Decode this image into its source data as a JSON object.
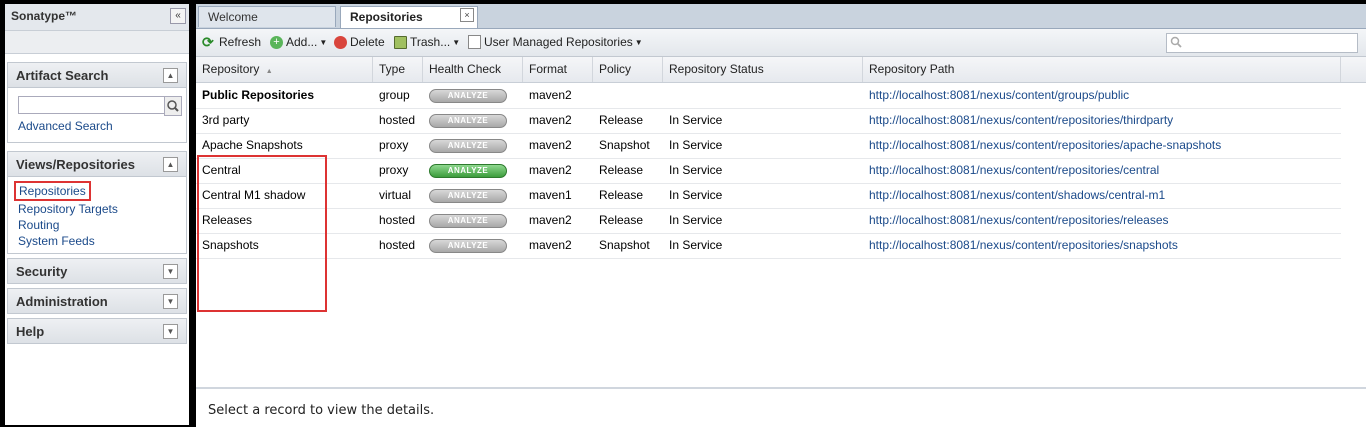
{
  "sidebar": {
    "brand": "Sonatype™",
    "collapse_glyph": "«",
    "artifact_search": {
      "title": "Artifact Search",
      "input_value": "",
      "advanced_link": "Advanced Search"
    },
    "views": {
      "title": "Views/Repositories",
      "items": [
        "Repositories",
        "Repository Targets",
        "Routing",
        "System Feeds"
      ]
    },
    "security": {
      "title": "Security"
    },
    "administration": {
      "title": "Administration"
    },
    "help": {
      "title": "Help"
    }
  },
  "tabs": {
    "welcome": "Welcome",
    "repositories": "Repositories",
    "close_glyph": "×"
  },
  "toolbar": {
    "refresh": "Refresh",
    "add": "Add...",
    "delete": "Delete",
    "trash": "Trash...",
    "user_managed": "User Managed Repositories",
    "filter_value": ""
  },
  "grid": {
    "columns": [
      "Repository",
      "Type",
      "Health Check",
      "Format",
      "Policy",
      "Repository Status",
      "Repository Path"
    ],
    "analyze_label": "ANALYZE",
    "rows": [
      {
        "name": "Public Repositories",
        "type": "group",
        "format": "maven2",
        "policy": "",
        "status": "",
        "path": "http://localhost:8081/nexus/content/groups/public",
        "bold": true,
        "green": false
      },
      {
        "name": "3rd party",
        "type": "hosted",
        "format": "maven2",
        "policy": "Release",
        "status": "In Service",
        "path": "http://localhost:8081/nexus/content/repositories/thirdparty",
        "bold": false,
        "green": false
      },
      {
        "name": "Apache Snapshots",
        "type": "proxy",
        "format": "maven2",
        "policy": "Snapshot",
        "status": "In Service",
        "path": "http://localhost:8081/nexus/content/repositories/apache-snapshots",
        "bold": false,
        "green": false
      },
      {
        "name": "Central",
        "type": "proxy",
        "format": "maven2",
        "policy": "Release",
        "status": "In Service",
        "path": "http://localhost:8081/nexus/content/repositories/central",
        "bold": false,
        "green": true
      },
      {
        "name": "Central M1 shadow",
        "type": "virtual",
        "format": "maven1",
        "policy": "Release",
        "status": "In Service",
        "path": "http://localhost:8081/nexus/content/shadows/central-m1",
        "bold": false,
        "green": false
      },
      {
        "name": "Releases",
        "type": "hosted",
        "format": "maven2",
        "policy": "Release",
        "status": "In Service",
        "path": "http://localhost:8081/nexus/content/repositories/releases",
        "bold": false,
        "green": false
      },
      {
        "name": "Snapshots",
        "type": "hosted",
        "format": "maven2",
        "policy": "Snapshot",
        "status": "In Service",
        "path": "http://localhost:8081/nexus/content/repositories/snapshots",
        "bold": false,
        "green": false
      }
    ]
  },
  "detail": {
    "message": "Select a record to view the details."
  }
}
